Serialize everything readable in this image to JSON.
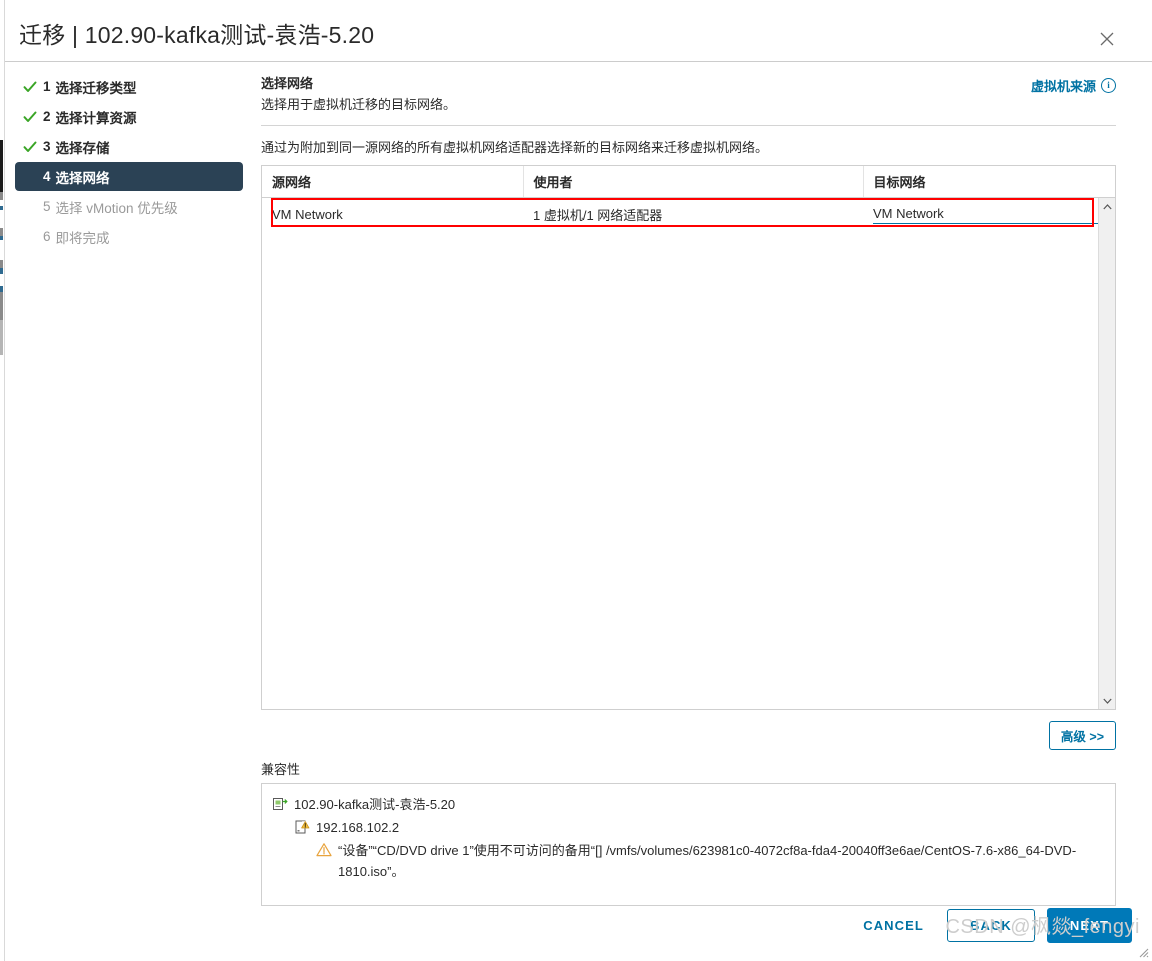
{
  "dialog": {
    "title": "迁移 | 102.90-kafka测试-袁浩-5.20",
    "close_label": "×"
  },
  "steps": [
    {
      "num": "1",
      "label": "选择迁移类型",
      "state": "done"
    },
    {
      "num": "2",
      "label": "选择计算资源",
      "state": "done"
    },
    {
      "num": "3",
      "label": "选择存储",
      "state": "done"
    },
    {
      "num": "4",
      "label": "选择网络",
      "state": "active"
    },
    {
      "num": "5",
      "label": "选择 vMotion 优先级",
      "state": "pending"
    },
    {
      "num": "6",
      "label": "即将完成",
      "state": "pending"
    }
  ],
  "pane": {
    "title": "选择网络",
    "subtitle": "选择用于虚拟机迁移的目标网络。",
    "source_link": "虚拟机来源",
    "info_icon_glyph": "i",
    "instruction": "通过为附加到同一源网络的所有虚拟机网络适配器选择新的目标网络来迁移虚拟机网络。"
  },
  "table": {
    "columns": [
      "源网络",
      "使用者",
      "目标网络"
    ],
    "rows": [
      {
        "source_network": "VM Network",
        "used_by": "1 虚拟机/1 网络适配器",
        "destination_network": "VM Network"
      }
    ]
  },
  "advanced": {
    "label": "高级 >>"
  },
  "compatibility": {
    "label": "兼容性",
    "vm_name": "102.90-kafka测试-袁浩-5.20",
    "host": "192.168.102.2",
    "warning": "“设备”“CD/DVD drive 1”使用不可访问的备用“[] /vmfs/volumes/623981c0-4072cf8a-fda4-20040ff3e6ae/CentOS-7.6-x86_64-DVD-1810.iso”。"
  },
  "footer": {
    "cancel": "CANCEL",
    "back": "BACK",
    "next": "NEXT"
  },
  "watermark": {
    "text": "CSDN @枫燚_fengyi"
  },
  "colors": {
    "accent": "#0072a3",
    "primary_button": "#0079b8",
    "active_step_bg": "#2b4255",
    "check_green": "#3aa526",
    "highlight_red": "#ff0000",
    "warning_amber": "#e8a33d"
  }
}
